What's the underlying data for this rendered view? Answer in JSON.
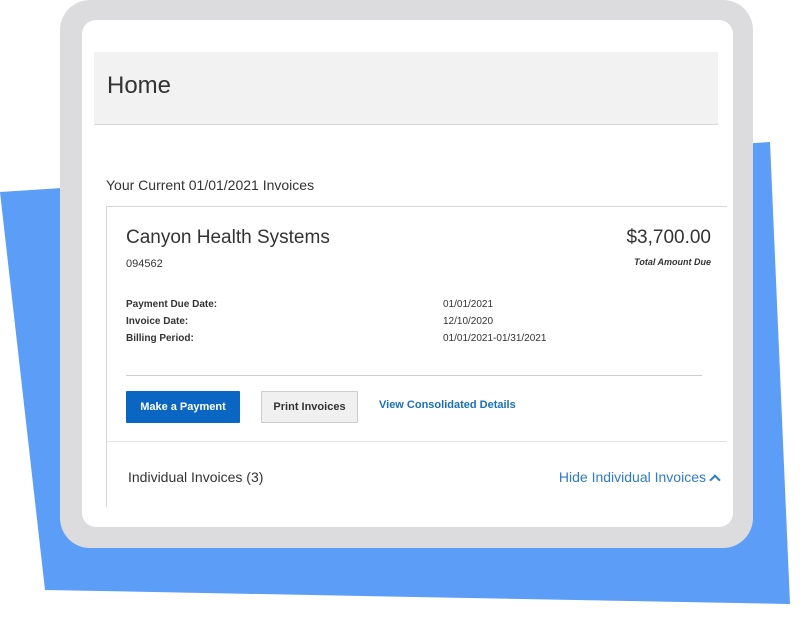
{
  "page": {
    "title": "Home"
  },
  "invoices_section": {
    "heading": "Your Current 01/01/2021 Invoices"
  },
  "invoice": {
    "company_name": "Canyon Health Systems",
    "account_number": "094562",
    "total_amount": "$3,700.00",
    "total_label": "Total Amount Due",
    "details": [
      {
        "label": "Payment Due Date:",
        "value": "01/01/2021"
      },
      {
        "label": "Invoice Date:",
        "value": "12/10/2020"
      },
      {
        "label": "Billing Period:",
        "value": "01/01/2021-01/31/2021"
      }
    ]
  },
  "actions": {
    "make_payment_label": "Make a Payment",
    "print_invoices_label": "Print Invoices",
    "view_details_label": "View Consolidated Details"
  },
  "individual_invoices": {
    "label": "Individual Invoices (3)",
    "toggle_label": "Hide Individual Invoices",
    "toggle_icon": "chevron-up-icon"
  },
  "colors": {
    "backdrop": "#5c9df7",
    "device_frame": "#dcdcde",
    "primary_button": "#0b66c3",
    "link": "#1a6fbf"
  }
}
